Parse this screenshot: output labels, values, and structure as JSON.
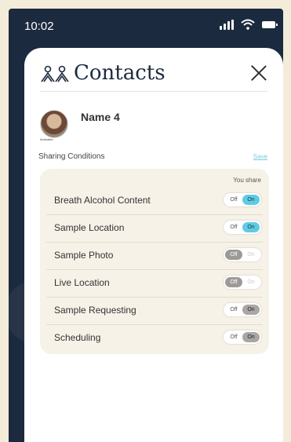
{
  "status": {
    "time": "10:02"
  },
  "header": {
    "title": "Contacts"
  },
  "contact": {
    "name": "Name 4",
    "avatar_status": "Activated"
  },
  "sharing": {
    "label": "Sharing Conditions",
    "save": "Save",
    "column_header": "You share",
    "rows": [
      {
        "label": "Breath Alcohol Content",
        "off": "Off",
        "on": "On",
        "state": "on"
      },
      {
        "label": "Sample Location",
        "off": "Off",
        "on": "On",
        "state": "on"
      },
      {
        "label": "Sample Photo",
        "off": "Off",
        "on": "On",
        "state": "off"
      },
      {
        "label": "Live Location",
        "off": "Off",
        "on": "On",
        "state": "off"
      },
      {
        "label": "Sample Requesting",
        "off": "Off",
        "on": "On",
        "state": "on-muted"
      },
      {
        "label": "Scheduling",
        "off": "Off",
        "on": "On",
        "state": "on-muted"
      }
    ]
  },
  "colors": {
    "background": "#1c2a3f",
    "accent": "#5fcbe3"
  }
}
